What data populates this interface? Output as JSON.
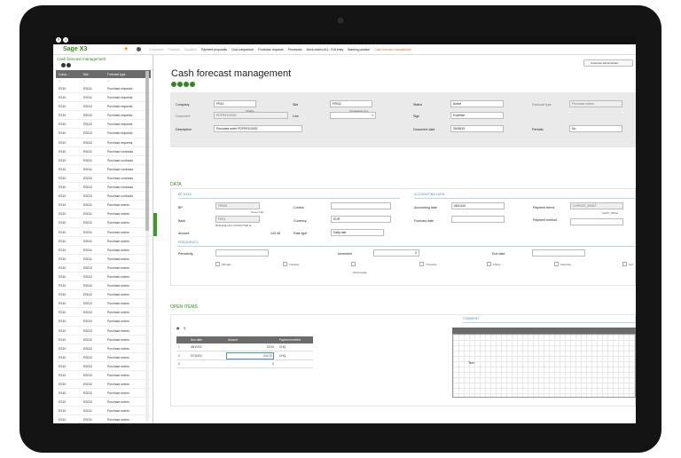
{
  "app": {
    "brand": "Sage X3",
    "nav_items": [
      {
        "label": "Customers",
        "state": "dim"
      },
      {
        "label": "Products",
        "state": "dim"
      },
      {
        "label": "Suppliers",
        "state": "dim"
      },
      {
        "label": "Payment proposals",
        "state": "normal"
      },
      {
        "label": "Cost comparison",
        "state": "normal"
      },
      {
        "label": "Purchase requests",
        "state": "normal"
      },
      {
        "label": "Processes",
        "state": "normal"
      },
      {
        "label": "Work orders ALL : Full entry",
        "state": "normal"
      },
      {
        "label": "Banking position",
        "state": "normal"
      },
      {
        "label": "Cash forecast management",
        "state": "current"
      }
    ],
    "customer_admin_label": "Customer Administrator"
  },
  "left_panel": {
    "title": "Cash forecast management",
    "columns": [
      "Comp...",
      "Site",
      "Forecast type"
    ],
    "rows": [
      [
        "ES10",
        "ES011",
        "Purchase requests"
      ],
      [
        "ES10",
        "ES011",
        "Purchase requests"
      ],
      [
        "ES10",
        "ES012",
        "Purchase requests"
      ],
      [
        "ES10",
        "ES012",
        "Purchase requests"
      ],
      [
        "ES10",
        "ES012",
        "Purchase requests"
      ],
      [
        "ES10",
        "ES012",
        "Purchase requests"
      ],
      [
        "ES10",
        "ES012",
        "Purchase requests"
      ],
      [
        "ES10",
        "ES011",
        "Purchase contracts"
      ],
      [
        "ES10",
        "ES011",
        "Purchase contracts"
      ],
      [
        "ES10",
        "ES011",
        "Purchase contracts"
      ],
      [
        "ES10",
        "ES012",
        "Purchase contracts"
      ],
      [
        "ES10",
        "ES012",
        "Purchase contracts"
      ],
      [
        "ES10",
        "ES012",
        "Purchase contracts"
      ],
      [
        "ES10",
        "ES011",
        "Purchase orders"
      ],
      [
        "ES10",
        "ES011",
        "Purchase orders"
      ],
      [
        "ES10",
        "ES011",
        "Purchase orders"
      ],
      [
        "ES10",
        "ES011",
        "Purchase orders"
      ],
      [
        "ES10",
        "ES011",
        "Purchase orders"
      ],
      [
        "ES10",
        "ES011",
        "Purchase orders"
      ],
      [
        "ES10",
        "ES011",
        "Purchase orders"
      ],
      [
        "ES10",
        "ES012",
        "Purchase orders"
      ],
      [
        "ES10",
        "ES012",
        "Purchase orders"
      ],
      [
        "ES10",
        "ES012",
        "Purchase orders"
      ],
      [
        "ES10",
        "ES012",
        "Purchase orders"
      ],
      [
        "ES10",
        "ES012",
        "Purchase orders"
      ],
      [
        "ES10",
        "ES012",
        "Purchase orders"
      ],
      [
        "ES10",
        "ES012",
        "Purchase orders"
      ],
      [
        "ES10",
        "ES012",
        "Purchase orders"
      ],
      [
        "ES10",
        "ES012",
        "Purchase orders"
      ],
      [
        "ES10",
        "ES012",
        "Purchase orders"
      ],
      [
        "ES10",
        "ES012",
        "Purchase orders"
      ],
      [
        "ES10",
        "ES012",
        "Purchase orders"
      ],
      [
        "ES10",
        "ES012",
        "Purchase orders"
      ],
      [
        "ES10",
        "ES012",
        "Purchase orders"
      ],
      [
        "ES10",
        "ES012",
        "Purchase orders"
      ],
      [
        "ES10",
        "ES012",
        "Purchase orders"
      ],
      [
        "ES10",
        "ES011",
        "Purchase orders"
      ],
      [
        "ES10",
        "ES011",
        "Purchase orders"
      ]
    ]
  },
  "page": {
    "title": "Cash forecast management"
  },
  "header": {
    "company_label": "Company",
    "company_value": "FR10",
    "company_desc": "Charlie",
    "site_label": "Site",
    "site_value": "FR011",
    "site_desc": "Compagnie CH",
    "status_label": "Status",
    "status_value": "Active",
    "forecast_type_label": "Forecast type",
    "forecast_type_value": "Purchase orders",
    "document_label": "Document",
    "document_value": "POFR0110032",
    "line_label": "Line",
    "line_value": "1",
    "sign_label": "Sign",
    "sign_value": "Expense",
    "description_label": "Description",
    "description_value": "Purchase order POFR0110032",
    "document_date_label": "Document date",
    "document_date_value": "05/08/15",
    "periodic_label": "Periodic",
    "periodic_value": "No"
  },
  "data_section": {
    "title": "DATA",
    "bp_data_title": "BP DATA",
    "accounting_title": "ACCOUNTING DATA",
    "bp_label": "BP",
    "bp_value": "FR004",
    "bp_desc": "Green Info",
    "control_label": "Control",
    "bank_label": "Bank",
    "bank_value": "FR01",
    "bank_desc": "BANQUE FR1 COMPUTER E...",
    "currency_label": "Currency",
    "currency_value": "EUR",
    "amount_label": "Amount",
    "amount_value": "143.46",
    "rate_type_label": "Rate type",
    "rate_type_value": "Daily rate",
    "accounting_date_label": "Accounting date",
    "accounting_date_value": "08/10/15",
    "forecast_date_label": "Forecast date",
    "payment_terms_label": "Payment terms",
    "payment_terms_value": "CHPROS_30NET",
    "payment_terms_desc": "CHPP_30Net",
    "payment_method_label": "Payment method",
    "frequency_title": "FREQUENCY",
    "periodicity_label": "Periodicity",
    "increment_label": "Increment",
    "increment_value": "0",
    "end_date_label": "End date",
    "days": [
      "Monday",
      "Tuesday",
      "Wednesday",
      "Thursday",
      "Friday",
      "Saturday",
      "Sun"
    ]
  },
  "open_items": {
    "title": "OPEN ITEMS",
    "comment_title": "COMMENT",
    "text_label": "Text",
    "columns": [
      "Due date",
      "Amount",
      "Payment method"
    ],
    "rows": [
      {
        "num": "1",
        "due_date": "08/10/15",
        "amount": "20.00",
        "method": "CHQ"
      },
      {
        "num": "2",
        "due_date": "07/10/15",
        "amount": "214.72",
        "method": "CHQ"
      },
      {
        "num": "3",
        "due_date": "",
        "amount": "0",
        "method": ""
      }
    ]
  }
}
